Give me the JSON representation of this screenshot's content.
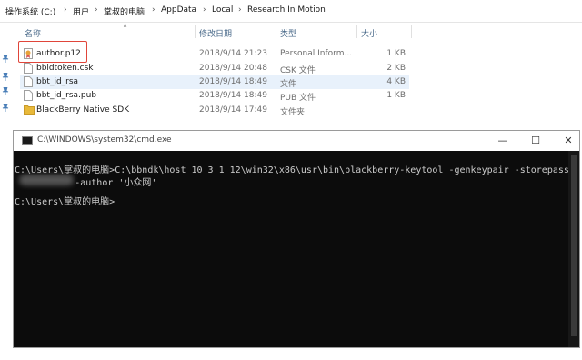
{
  "breadcrumb": {
    "items": [
      "操作系统 (C:)",
      "用户",
      "掌叔的电脑",
      "AppData",
      "Local",
      "Research In Motion"
    ],
    "separator": "›"
  },
  "columns": {
    "name": "名称",
    "date": "修改日期",
    "type": "类型",
    "size": "大小"
  },
  "files": [
    {
      "name": "author.p12",
      "date": "2018/9/14 21:23",
      "type": "Personal Inform...",
      "size": "1 KB",
      "icon": "certificate-file-icon"
    },
    {
      "name": "bbidtoken.csk",
      "date": "2018/9/14 20:48",
      "type": "CSK 文件",
      "size": "2 KB",
      "icon": "generic-file-icon"
    },
    {
      "name": "bbt_id_rsa",
      "date": "2018/9/14 18:49",
      "type": "文件",
      "size": "4 KB",
      "icon": "generic-file-icon"
    },
    {
      "name": "bbt_id_rsa.pub",
      "date": "2018/9/14 18:49",
      "type": "PUB 文件",
      "size": "1 KB",
      "icon": "generic-file-icon"
    },
    {
      "name": "BlackBerry Native SDK",
      "date": "2018/9/14 17:49",
      "type": "文件夹",
      "size": "",
      "icon": "folder-icon"
    }
  ],
  "cmd": {
    "title": "C:\\WINDOWS\\system32\\cmd.exe",
    "lines": [
      "C:\\Users\\掌叔的电脑>C:\\bbndk\\host_10_3_1_12\\win32\\x86\\usr\\bin\\blackberry-keytool -genkeypair -storepass",
      "           -author '小众网'",
      "",
      "C:\\Users\\掌叔的电脑>"
    ],
    "controls": {
      "minimize": "—",
      "maximize": "☐",
      "close": "✕"
    }
  },
  "colors": {
    "highlight": "#e0453a",
    "selected_row": "#e8f1fb",
    "folder": "#e8b93a",
    "console_bg": "#0c0c0c"
  }
}
